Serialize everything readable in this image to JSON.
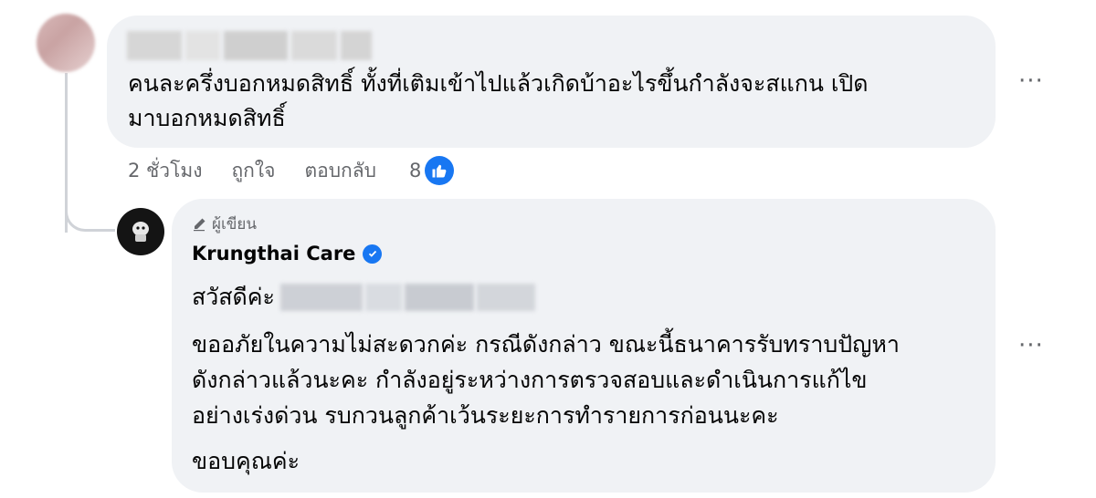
{
  "comment": {
    "text_line1": "คนละครึ่งบอกหมดสิทธิ์ ทั้งที่เติมเข้าไปแล้วเกิดบ้าอะไรขึ้นกำลังจะสแกน เปิด",
    "text_line2": "มาบอกหมดสิทธิ์",
    "more_label": "···",
    "avatar_color": "#d8b8b8"
  },
  "actions": {
    "time": "2 ชั่วโมง",
    "like": "ถูกใจ",
    "reply": "ตอบกลับ",
    "like_count": "8",
    "like_icon": "thumbs-up-icon",
    "like_color": "#1877f2"
  },
  "reply": {
    "author_tag": "ผู้เขียน",
    "author_tag_icon": "pencil-icon",
    "page_name": "Krungthai Care",
    "verified_icon": "verified-badge-icon",
    "greeting": "สวัสดีค่ะ",
    "body_line1": "ขออภัยในความไม่สะดวกค่ะ กรณีดังกล่าว ขณะนี้ธนาคารรับทราบปัญหา",
    "body_line2": "ดังกล่าวแล้วนะคะ กำลังอยู่ระหว่างการตรวจสอบและดำเนินการแก้ไข",
    "body_line3": "อย่างเร่งด่วน รบกวนลูกค้าเว้นระยะการทำรายการก่อนนะคะ",
    "thanks": "ขอบคุณค่ะ",
    "more_label": "···"
  },
  "colors": {
    "bubble_bg": "#f0f2f5",
    "secondary_text": "#65676b",
    "accent": "#1877f2"
  }
}
